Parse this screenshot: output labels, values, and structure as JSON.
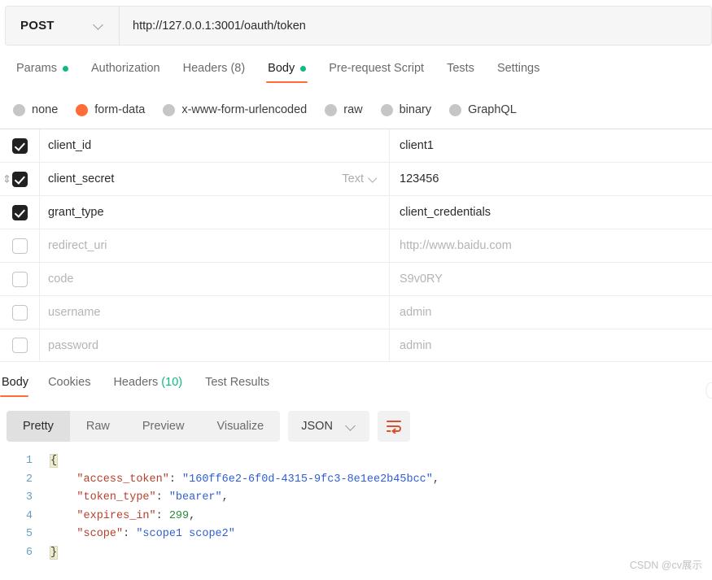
{
  "request": {
    "method": "POST",
    "url": "http://127.0.0.1:3001/oauth/token",
    "tabs": [
      {
        "label": "Params",
        "dot": true,
        "active": false
      },
      {
        "label": "Authorization",
        "dot": false,
        "active": false
      },
      {
        "label": "Headers (8)",
        "dot": false,
        "active": false
      },
      {
        "label": "Body",
        "dot": true,
        "active": true
      },
      {
        "label": "Pre-request Script",
        "dot": false,
        "active": false
      },
      {
        "label": "Tests",
        "dot": false,
        "active": false
      },
      {
        "label": "Settings",
        "dot": false,
        "active": false
      }
    ],
    "body_types": [
      {
        "label": "none",
        "selected": false
      },
      {
        "label": "form-data",
        "selected": true
      },
      {
        "label": "x-www-form-urlencoded",
        "selected": false
      },
      {
        "label": "raw",
        "selected": false
      },
      {
        "label": "binary",
        "selected": false
      },
      {
        "label": "GraphQL",
        "selected": false
      }
    ],
    "form_rows": [
      {
        "checked": true,
        "key": "client_id",
        "value": "client1",
        "type": "",
        "drag": false
      },
      {
        "checked": true,
        "key": "client_secret",
        "value": "123456",
        "type": "Text",
        "drag": true
      },
      {
        "checked": true,
        "key": "grant_type",
        "value": "client_credentials",
        "type": "",
        "drag": false
      },
      {
        "checked": false,
        "key": "redirect_uri",
        "value": "http://www.baidu.com",
        "type": "",
        "drag": false
      },
      {
        "checked": false,
        "key": "code",
        "value": "S9v0RY",
        "type": "",
        "drag": false
      },
      {
        "checked": false,
        "key": "username",
        "value": "admin",
        "type": "",
        "drag": false
      },
      {
        "checked": false,
        "key": "password",
        "value": "admin",
        "type": "",
        "drag": false
      }
    ]
  },
  "response": {
    "tabs": [
      {
        "label": "Body",
        "active": true,
        "count": ""
      },
      {
        "label": "Cookies",
        "active": false,
        "count": ""
      },
      {
        "label": "Headers",
        "active": false,
        "count": "(10)"
      },
      {
        "label": "Test Results",
        "active": false,
        "count": ""
      }
    ],
    "format_tabs": [
      {
        "label": "Pretty",
        "active": true
      },
      {
        "label": "Raw",
        "active": false
      },
      {
        "label": "Preview",
        "active": false
      },
      {
        "label": "Visualize",
        "active": false
      }
    ],
    "language": "JSON",
    "body": {
      "access_token": "160ff6e2-6f0d-4315-9fc3-8e1ee2b45bcc",
      "token_type": "bearer",
      "expires_in": 299,
      "scope": "scope1 scope2"
    },
    "line_numbers": [
      "1",
      "2",
      "3",
      "4",
      "5",
      "6"
    ]
  },
  "colors": {
    "accent": "#ff6c37",
    "success": "#10b981",
    "checkbox_checked": "#212121"
  },
  "watermark": "CSDN @cv展示"
}
